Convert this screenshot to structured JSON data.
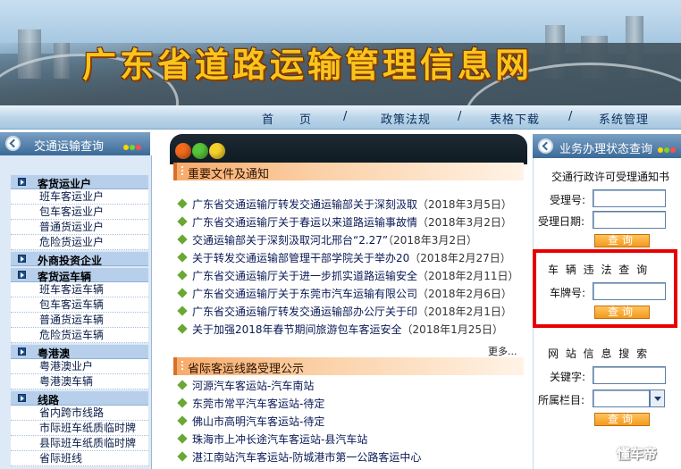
{
  "site": {
    "title": "广东省道路运输管理信息网"
  },
  "nav": {
    "items": [
      "首　　页",
      "政策法规",
      "表格下载",
      "系统管理"
    ],
    "separator": "/"
  },
  "left": {
    "header": "交通运输查询",
    "categories": [
      {
        "label": "客货运业户",
        "items": [
          "班车客运业户",
          "包车客运业户",
          "普通货运业户",
          "危险货运业户"
        ]
      },
      {
        "label": "外商投资企业",
        "items": []
      },
      {
        "label": "客货运车辆",
        "items": [
          "班车客运车辆",
          "包车客运车辆",
          "普通货运车辆",
          "危险货运车辆"
        ]
      },
      {
        "label": "粤港澳",
        "items": [
          "粤港澳业户",
          "粤港澳车辆"
        ]
      },
      {
        "label": "线路",
        "items": [
          "省内跨市线路",
          "市际班车纸质临时牌",
          "县际班车纸质临时牌",
          "省际班线"
        ]
      }
    ]
  },
  "center": {
    "section1_title": "重要文件及通知",
    "news": [
      {
        "title": "广东省交通运输厅转发交通运输部关于深刻汲取",
        "date": "（2018年3月5日）"
      },
      {
        "title": "广东省交通运输厅关于春运以来道路运输事故情",
        "date": "（2018年3月2日）"
      },
      {
        "title": "交通运输部关于深刻汲取河北邢台“2.27”",
        "date": "（2018年3月2日）"
      },
      {
        "title": "关于转发交通运输部管理干部学院关于举办20",
        "date": "（2018年2月27日）"
      },
      {
        "title": "广东省交通运输厅关于进一步抓实道路运输安全",
        "date": "（2018年2月11日）"
      },
      {
        "title": "广东省交通运输厅关于东莞市汽车运输有限公司",
        "date": "（2018年2月6日）"
      },
      {
        "title": "广东省交通运输厅转发交通运输部办公厅关于印",
        "date": "（2018年2月1日）"
      },
      {
        "title": "关于加强2018年春节期间旅游包车客运安全",
        "date": "（2018年1月25日）"
      }
    ],
    "more": "更多...",
    "section2_title": "省际客运线路受理公示",
    "routes": [
      "河源汽车客运站-汽车南站",
      "东莞市常平汽车客运站-待定",
      "佛山市高明汽车客运站-待定",
      "珠海市上冲长途汽车客运站-县汽车站",
      "湛江南站汽车客运站-防城港市第一公路客运中心"
    ]
  },
  "right": {
    "header": "业务办理状态查询",
    "permit_title": "交通行政许可受理通知书",
    "accept_no_label": "受理号:",
    "accept_date_label": "受理日期:",
    "query_btn": "查询",
    "violation_title": "车 辆 违 法 查 询",
    "plate_label": "车牌号:",
    "search_title": "网 站 信 息 搜 索",
    "keyword_label": "关键字:",
    "column_label": "所属栏目:"
  },
  "watermark": "懂车帝",
  "colors": {
    "title_gold": "#f7c51c",
    "nav_blue": "#3b6a98",
    "highlight_red": "#e60000",
    "button_orange": "#f39a1e",
    "bullet_green": "#6aa834"
  }
}
